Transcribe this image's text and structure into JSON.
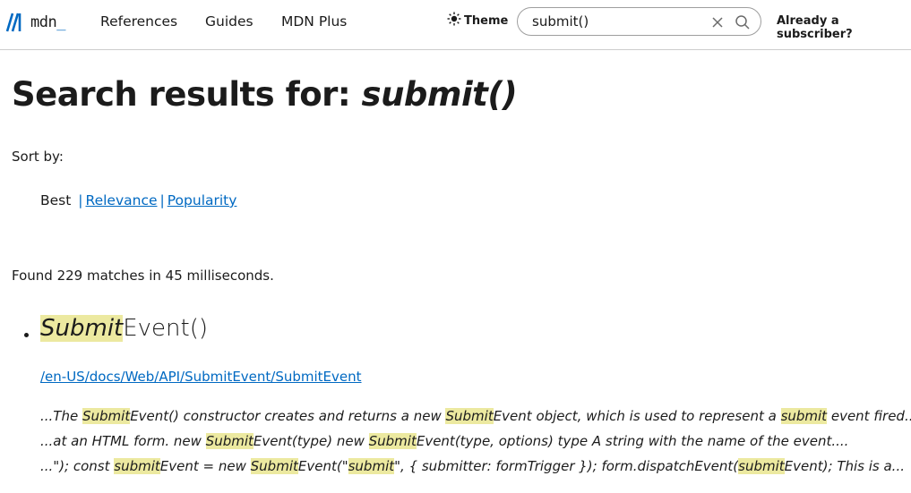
{
  "header": {
    "logo_text": "mdn",
    "logo_underscore": "_",
    "nav": [
      "References",
      "Guides",
      "MDN Plus"
    ],
    "theme_label": "Theme",
    "search_value": "submit()",
    "subscriber_label": "Already a subscriber?"
  },
  "main": {
    "title_prefix": "Search results for: ",
    "title_query": "submit()",
    "sort_label": "Sort by:",
    "sort_options": [
      "Best",
      "Relevance",
      "Popularity"
    ],
    "sort_separator": "|",
    "found_text": "Found 229 matches in 45 milliseconds."
  },
  "results": [
    {
      "title_highlight": "Submit",
      "title_rest": "Event()",
      "url": "/en-US/docs/Web/API/SubmitEvent/SubmitEvent",
      "excerpts": [
        [
          {
            "t": "...The ",
            "h": false
          },
          {
            "t": "Submit",
            "h": true
          },
          {
            "t": "Event() constructor creates and returns a new ",
            "h": false
          },
          {
            "t": "Submit",
            "h": true
          },
          {
            "t": "Event object, which is used to represent a ",
            "h": false
          },
          {
            "t": "submit",
            "h": true
          },
          {
            "t": " event fired...",
            "h": false
          }
        ],
        [
          {
            "t": "...at an HTML form. new ",
            "h": false
          },
          {
            "t": "Submit",
            "h": true
          },
          {
            "t": "Event(type) new ",
            "h": false
          },
          {
            "t": "Submit",
            "h": true
          },
          {
            "t": "Event(type, options) type A string with the name of the event....",
            "h": false
          }
        ],
        [
          {
            "t": "...\"); const ",
            "h": false
          },
          {
            "t": "submit",
            "h": true
          },
          {
            "t": "Event = new ",
            "h": false
          },
          {
            "t": "Submit",
            "h": true
          },
          {
            "t": "Event(\"",
            "h": false
          },
          {
            "t": "submit",
            "h": true
          },
          {
            "t": "\", { submitter: formTrigger }); form.dispatchEvent(",
            "h": false
          },
          {
            "t": "submit",
            "h": true
          },
          {
            "t": "Event); This is a...",
            "h": false
          }
        ]
      ]
    }
  ],
  "colors": {
    "link": "#0069c2",
    "highlight": "#ece9a0",
    "text": "#1b1b1b"
  },
  "icons": [
    "mdn-logo-icon",
    "sun-icon",
    "clear-icon",
    "search-icon"
  ]
}
